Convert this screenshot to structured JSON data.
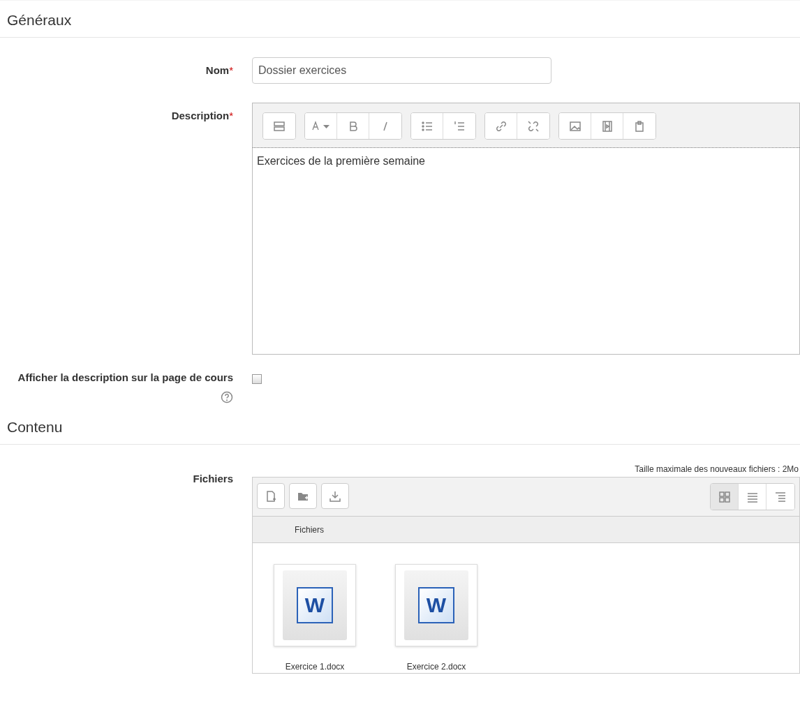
{
  "sections": [
    {
      "title": "Généraux"
    },
    {
      "title": "Contenu"
    }
  ],
  "name_field": {
    "label": "Nom",
    "required_mark": "*",
    "value": "Dossier exercices"
  },
  "description": {
    "label": "Description",
    "required_mark": "*",
    "text": "Exercices de la première semaine"
  },
  "show_description": {
    "label": "Afficher la description sur la page de cours",
    "checked": false
  },
  "files": {
    "label": "Fichiers",
    "max_size": "Taille maximale des nouveaux fichiers : 2Mo",
    "column_header": "Fichiers",
    "views": [
      {
        "kind": "icons",
        "selected": true
      },
      {
        "kind": "list",
        "selected": false
      },
      {
        "kind": "tree",
        "selected": false
      }
    ],
    "items": [
      {
        "name": "Exercice 1.docx",
        "badge": "W"
      },
      {
        "name": "Exercice 2.docx",
        "badge": "W"
      }
    ]
  }
}
